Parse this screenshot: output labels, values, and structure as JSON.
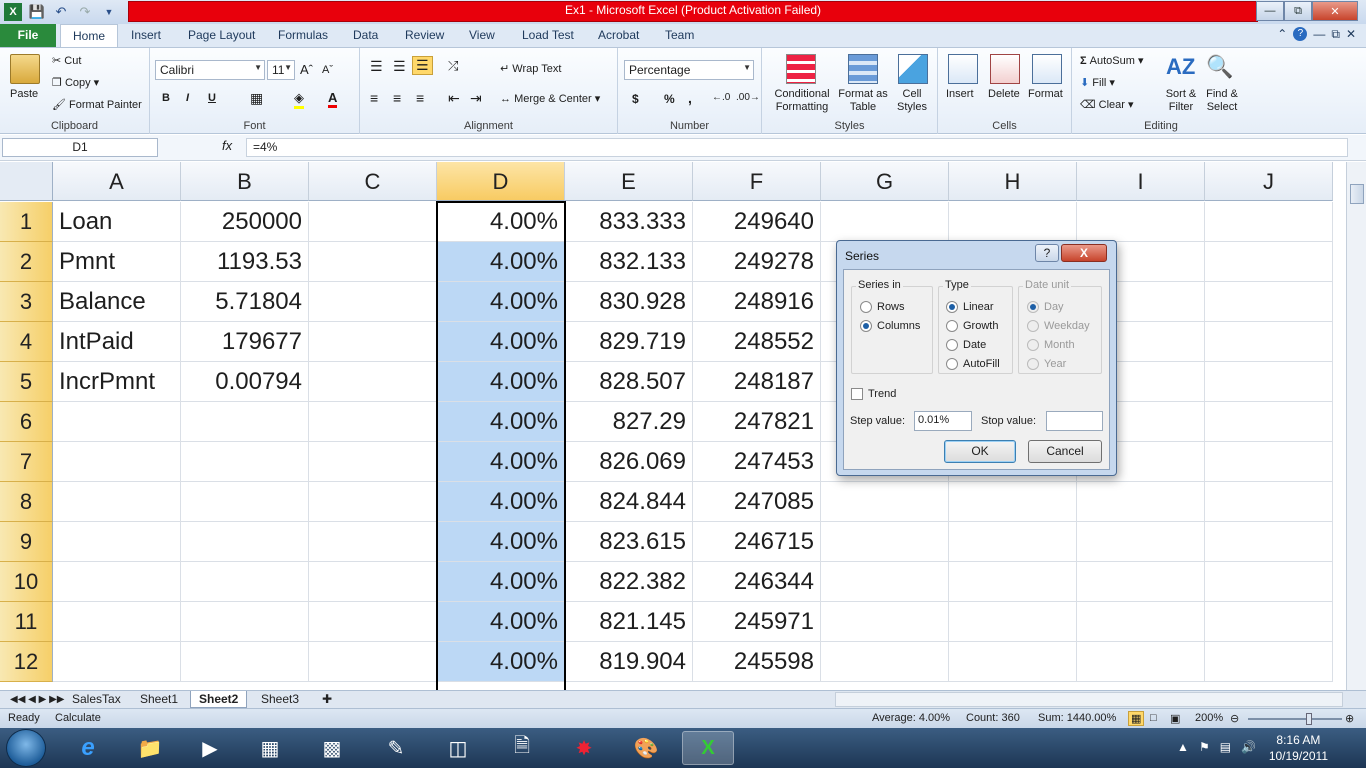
{
  "window": {
    "title": "Ex1  -  Microsoft Excel (Product Activation Failed)"
  },
  "ribbon_tabs": [
    "File",
    "Home",
    "Insert",
    "Page Layout",
    "Formulas",
    "Data",
    "Review",
    "View",
    "Load Test",
    "Acrobat",
    "Team"
  ],
  "ribbon": {
    "clipboard": {
      "paste": "Paste",
      "cut": "Cut",
      "copy": "Copy",
      "format_painter": "Format Painter",
      "label": "Clipboard"
    },
    "font": {
      "name": "Calibri",
      "size": "11",
      "bold": "B",
      "italic": "I",
      "underline": "U",
      "label": "Font"
    },
    "alignment": {
      "wrap_text": "Wrap Text",
      "merge_center": "Merge & Center",
      "label": "Alignment"
    },
    "number": {
      "format": "Percentage",
      "currency": "$",
      "percent": "%",
      "comma": ",",
      "label": "Number"
    },
    "styles": {
      "conditional_formatting": "Conditional Formatting",
      "format_as_table": "Format as Table",
      "cell_styles": "Cell Styles",
      "label": "Styles"
    },
    "cells": {
      "insert": "Insert",
      "delete": "Delete",
      "format": "Format",
      "label": "Cells"
    },
    "editing": {
      "autosum": "AutoSum",
      "fill": "Fill",
      "clear": "Clear",
      "sort_filter": "Sort & Filter",
      "find_select": "Find & Select",
      "label": "Editing"
    }
  },
  "formula_bar": {
    "name_box": "D1",
    "fx": "fx",
    "formula": "=4%"
  },
  "columns": [
    "A",
    "B",
    "C",
    "D",
    "E",
    "F",
    "G",
    "H",
    "I",
    "J"
  ],
  "rows": [
    {
      "n": "1",
      "A": "Loan",
      "B": "250000",
      "D": "4.00%",
      "E": "833.333",
      "F": "249640"
    },
    {
      "n": "2",
      "A": "Pmnt",
      "B": "1193.53",
      "D": "4.00%",
      "E": "832.133",
      "F": "249278"
    },
    {
      "n": "3",
      "A": "Balance",
      "B": "5.71804",
      "D": "4.00%",
      "E": "830.928",
      "F": "248916"
    },
    {
      "n": "4",
      "A": "IntPaid",
      "B": "179677",
      "D": "4.00%",
      "E": "829.719",
      "F": "248552"
    },
    {
      "n": "5",
      "A": "IncrPmnt",
      "B": "0.00794",
      "D": "4.00%",
      "E": "828.507",
      "F": "248187"
    },
    {
      "n": "6",
      "A": "",
      "B": "",
      "D": "4.00%",
      "E": "827.29",
      "F": "247821"
    },
    {
      "n": "7",
      "A": "",
      "B": "",
      "D": "4.00%",
      "E": "826.069",
      "F": "247453"
    },
    {
      "n": "8",
      "A": "",
      "B": "",
      "D": "4.00%",
      "E": "824.844",
      "F": "247085"
    },
    {
      "n": "9",
      "A": "",
      "B": "",
      "D": "4.00%",
      "E": "823.615",
      "F": "246715"
    },
    {
      "n": "10",
      "A": "",
      "B": "",
      "D": "4.00%",
      "E": "822.382",
      "F": "246344"
    },
    {
      "n": "11",
      "A": "",
      "B": "",
      "D": "4.00%",
      "E": "821.145",
      "F": "245971"
    },
    {
      "n": "12",
      "A": "",
      "B": "",
      "D": "4.00%",
      "E": "819.904",
      "F": "245598"
    }
  ],
  "sheet_tabs": [
    "SalesTax",
    "Sheet1",
    "Sheet2",
    "Sheet3"
  ],
  "active_sheet": "Sheet2",
  "status": {
    "ready": "Ready",
    "calculate": "Calculate",
    "average": "Average: 4.00%",
    "count": "Count: 360",
    "sum": "Sum: 1440.00%",
    "zoom": "200%"
  },
  "dialog": {
    "title": "Series",
    "help": "?",
    "close": "X",
    "series_in": {
      "label": "Series in",
      "rows": "Rows",
      "columns": "Columns"
    },
    "type": {
      "label": "Type",
      "linear": "Linear",
      "growth": "Growth",
      "date": "Date",
      "autofill": "AutoFill"
    },
    "date_unit": {
      "label": "Date unit",
      "day": "Day",
      "weekday": "Weekday",
      "month": "Month",
      "year": "Year"
    },
    "trend": "Trend",
    "step_label": "Step value:",
    "step_value": "0.01%",
    "stop_label": "Stop value:",
    "stop_value": "",
    "ok": "OK",
    "cancel": "Cancel"
  },
  "taskbar": {
    "time": "8:16 AM",
    "date": "10/19/2011"
  },
  "colors": {
    "title_red": "#e8000c",
    "selection_blue": "#bcd8f5",
    "header_gold": "#f6cf68",
    "file_tab_green": "#2a8a3c"
  }
}
